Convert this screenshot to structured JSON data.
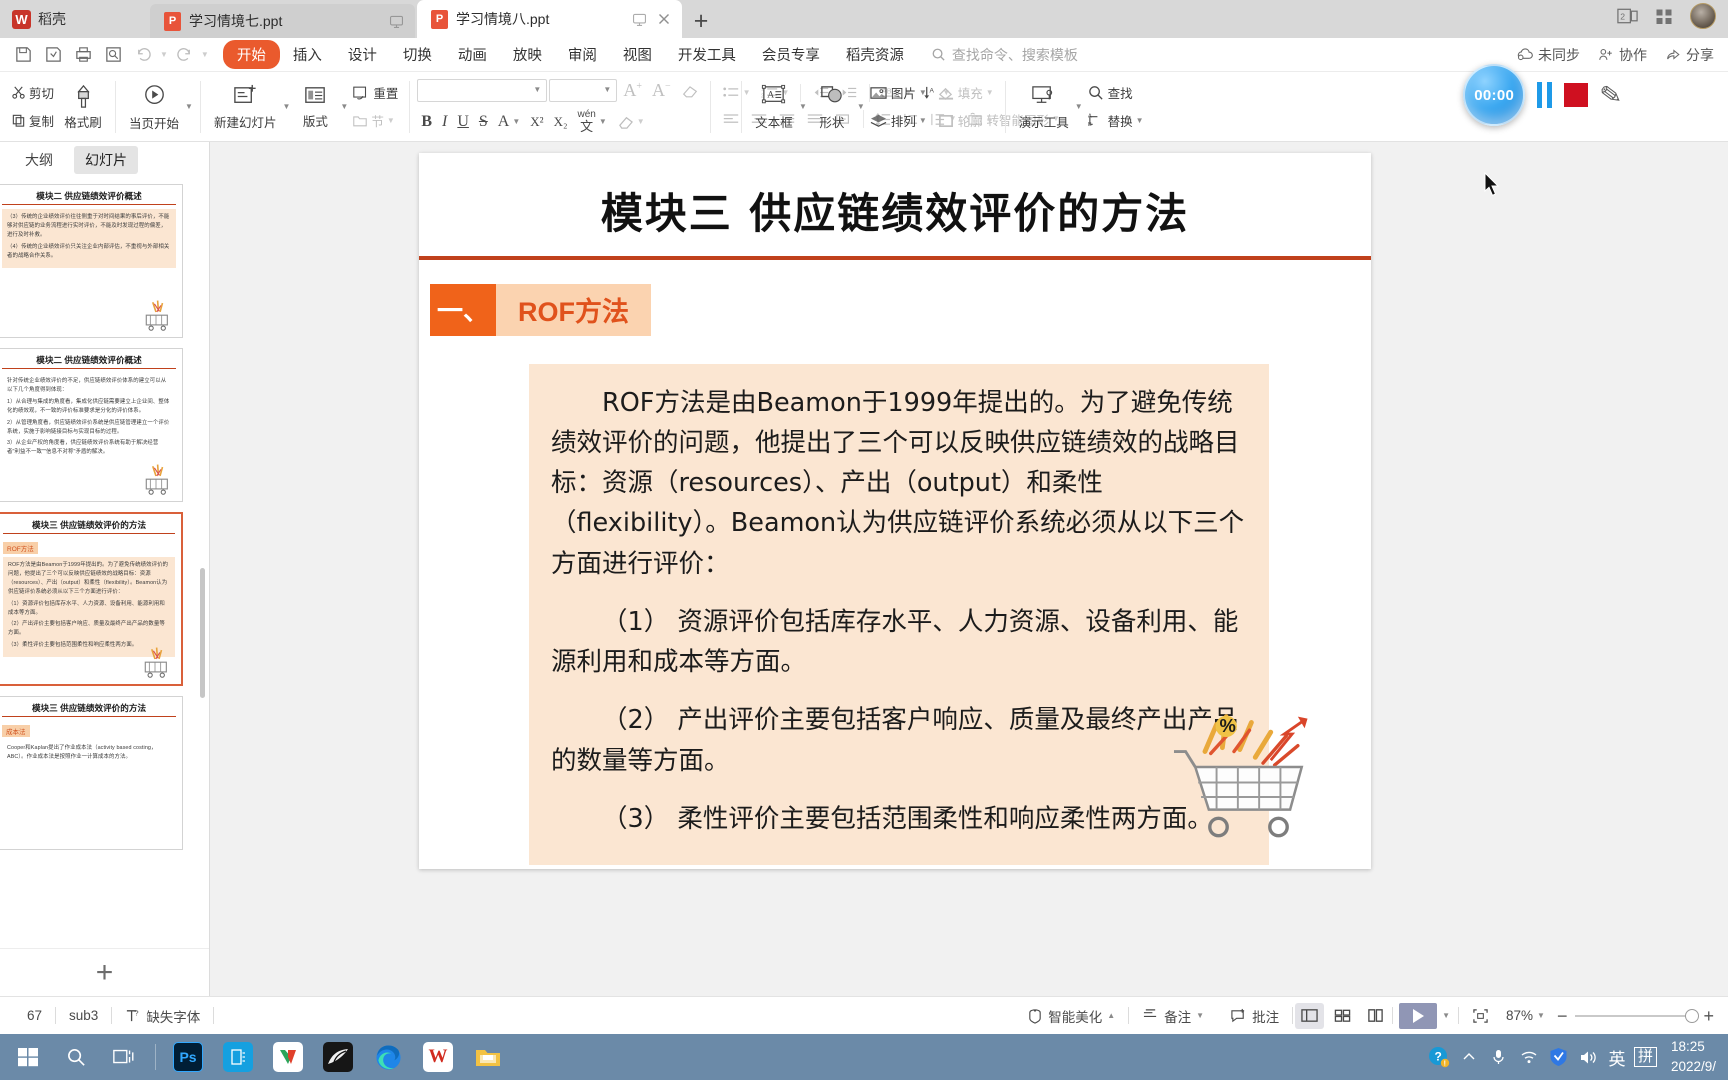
{
  "tabbar": {
    "brand": "稻壳",
    "brand_mark": "W",
    "tabs": [
      {
        "label": "学习情境七.ppt",
        "icon": "P",
        "active": false
      },
      {
        "label": "学习情境八.ppt",
        "icon": "P",
        "active": true
      }
    ],
    "new_tab": "+",
    "right_icons": [
      "two-pane-icon",
      "grid-icon",
      "avatar"
    ]
  },
  "menubar": {
    "quick_access": [
      "save-icon",
      "save-as-icon",
      "print-icon",
      "print-preview-icon",
      "undo-icon",
      "redo-icon",
      "customize-icon"
    ],
    "items": [
      {
        "label": "开始",
        "active": true
      },
      {
        "label": "插入",
        "active": false
      },
      {
        "label": "设计",
        "active": false
      },
      {
        "label": "切换",
        "active": false
      },
      {
        "label": "动画",
        "active": false
      },
      {
        "label": "放映",
        "active": false
      },
      {
        "label": "审阅",
        "active": false
      },
      {
        "label": "视图",
        "active": false
      },
      {
        "label": "开发工具",
        "active": false
      },
      {
        "label": "会员专享",
        "active": false
      },
      {
        "label": "稻壳资源",
        "active": false
      }
    ],
    "search_placeholder": "查找命令、搜索模板",
    "right": [
      {
        "label": "未同步",
        "icon": "cloud-sync-icon"
      },
      {
        "label": "协作",
        "icon": "collaborate-icon"
      },
      {
        "label": "分享",
        "icon": "share-icon"
      }
    ]
  },
  "ribbon": {
    "clipboard": [
      {
        "label": "剪切",
        "icon": "scissors-icon"
      },
      {
        "label": "复制",
        "icon": "copy-icon"
      },
      {
        "label": "格式刷",
        "icon": "format-painter-icon"
      }
    ],
    "present": {
      "label": "当页开始",
      "icon": "play-circle-icon"
    },
    "slides": [
      {
        "label": "新建幻灯片",
        "icon": "new-slide-icon"
      },
      {
        "label": "版式",
        "icon": "layout-icon"
      },
      {
        "label": "重置",
        "icon": "reset-icon"
      },
      {
        "label": "节",
        "icon": "section-icon"
      }
    ],
    "font": {
      "family_value": "",
      "size_value": "",
      "grow_label": "A",
      "shrink_label": "A",
      "clear_format_icon": "eraser-icon",
      "bold": "B",
      "italic": "I",
      "underline": "U",
      "strike": "S",
      "text_effect": "A",
      "superscript": "X²",
      "subscript": "X₂",
      "pinyin": "wén",
      "highlight_icon": "highlight-icon"
    },
    "paragraph": [
      {
        "label": "对齐文本",
        "icon": "align-text-icon"
      },
      {
        "label": "转智能图形",
        "icon": "smart-art-icon"
      }
    ],
    "drawing": [
      {
        "label": "文本框",
        "icon": "text-box-icon"
      },
      {
        "label": "形状",
        "icon": "shapes-icon"
      },
      {
        "label": "图片",
        "icon": "picture-icon"
      },
      {
        "label": "填充",
        "icon": "fill-icon"
      },
      {
        "label": "排列",
        "icon": "arrange-icon"
      },
      {
        "label": "轮廓",
        "icon": "outline-icon"
      }
    ],
    "tools": [
      {
        "label": "演示工具",
        "icon": "present-tools-icon"
      },
      {
        "label": "查找",
        "icon": "search-icon"
      },
      {
        "label": "替换",
        "icon": "replace-icon"
      }
    ],
    "recorder": {
      "timer": "00:00",
      "pause_icon": "pause-icon",
      "stop_icon": "stop-icon",
      "pen_icon": "pen-icon"
    }
  },
  "sidebar": {
    "tabs": [
      {
        "label": "大纲",
        "active": false
      },
      {
        "label": "幻灯片",
        "active": true
      }
    ],
    "add_button": "+",
    "thumbnails": [
      {
        "title": "模块二  供应链绩效评价概述",
        "tag": "",
        "lines": [
          "（3）传统的企业绩效评价往往侧重于对时间结果的事后评价，不能够对供应链的业务流程进行实时评价，不能及时发现过程的偏差，进行及时补救。",
          "（4）传统的企业绩效评价只关注企业内部评估，不重视与外部相关者的战略合作关系。"
        ],
        "selected": false
      },
      {
        "title": "模块二  供应链绩效评价概述",
        "tag": "",
        "lines": [
          "针对传统企业绩效评价的不足，供应链绩效评价体系的建立可以从以下几个角度得到体现：",
          "1）从合理与集成的角度看，集成化供应链需要建立上企业间、整体化的绩效观，不一致的评价标准要求是分化的评价体系。",
          "2）从管理角度看，供应链绩效评价系统是供应链管理建立一个评价系统，实施于影响链接目标与实现目标的过程。",
          "3）从企业产权的角度看，供应链绩效评价系统有助于解决经营者\"利益不一致\"\"信息不对称\"矛盾的解决。"
        ],
        "selected": false
      },
      {
        "title": "模块三  供应链绩效评价的方法",
        "tag": "ROF方法",
        "lines": [
          "ROF方法是由Beamon于1999年提出的。为了避免传统绩效评价的问题，他提出了三个可以反映供应链绩效的战略目标：资源（resources）、产出（output）和柔性（flexibility）。Beamon认为供应链评价系统必须从以下三个方面进行评价：",
          "（1）资源评价包括库存水平、人力资源、设备利用、能源利用和成本等方面。",
          "（2）产出评价主要包括客户响应、质量及最终产出产品的数量等方面。",
          "（3）柔性评价主要包括范围柔性和响应柔性两方面。"
        ],
        "selected": true
      },
      {
        "title": "模块三  供应链绩效评价的方法",
        "tag": "成本法",
        "lines": [
          "Cooper和Kaplan提出了作业成本法（activity based costing，ABC）。作业成本法是按照作业一计算成本的方法。"
        ],
        "selected": false
      }
    ]
  },
  "slide": {
    "title": "模块三   供应链绩效评价的方法",
    "section_number": "一、",
    "section_name": "ROF方法",
    "paragraphs": [
      "ROF方法是由Beamon于1999年提出的。为了避免传统绩效评价的问题，他提出了三个可以反映供应链绩效的战略目标：资源（resources）、产出（output）和柔性（flexibility）。Beamon认为供应链评价系统必须从以下三个方面进行评价：",
      "（1） 资源评价包括库存水平、人力资源、设备利用、能源利用和成本等方面。",
      "（2） 产出评价主要包括客户响应、质量及最终产出产品的数量等方面。",
      "（3） 柔性评价主要包括范围柔性和响应柔性两方面。"
    ],
    "decoration": "shopping-cart-graphic"
  },
  "statusbar": {
    "page_info": "67",
    "layout_name": "sub3",
    "font_warning": "缺失字体",
    "beautify": "智能美化",
    "notes": "备注",
    "comments": "批注",
    "views": [
      "normal-view-icon",
      "slide-sorter-icon",
      "reading-view-icon"
    ],
    "play": "play-icon",
    "zoom_level": "87%",
    "zoom_out": "−",
    "zoom_in": "+"
  },
  "taskbar": {
    "start_icon": "windows-start-icon",
    "search_icon": "search-icon",
    "taskview_icon": "task-view-icon",
    "apps": [
      {
        "name": "photoshop",
        "label": "Ps",
        "bg": "#001e36",
        "fg": "#31a8ff"
      },
      {
        "name": "scanner-app",
        "label": "",
        "bg": "#15a0e0",
        "fg": "#ffffff"
      },
      {
        "name": "wps-office",
        "label": "",
        "bg": "#ffffff",
        "fg": "#e84a2f"
      },
      {
        "name": "image-viewer",
        "label": "",
        "bg": "#1b1b1b",
        "fg": "#e8e8e8"
      },
      {
        "name": "microsoft-edge",
        "label": "",
        "bg": "#ffffff",
        "fg": "#0b7fd4"
      },
      {
        "name": "wps-writer",
        "label": "W",
        "bg": "#ffffff",
        "fg": "#d12b1f"
      },
      {
        "name": "file-explorer",
        "label": "",
        "bg": "#f5c243",
        "fg": "#f8d98c"
      }
    ],
    "tray": [
      {
        "name": "help-icon",
        "glyph": "?"
      },
      {
        "name": "show-hidden-icons",
        "glyph": "︿"
      },
      {
        "name": "microphone-icon",
        "glyph": "🎙"
      },
      {
        "name": "wifi-icon",
        "glyph": "◌"
      },
      {
        "name": "security-shield-icon",
        "glyph": "🛡"
      },
      {
        "name": "volume-icon",
        "glyph": "🔊"
      }
    ],
    "ime_lang": "英",
    "ime_mode": "拼",
    "clock_time": "18:25",
    "clock_date": "2022/9/"
  },
  "colors": {
    "accent_orange": "#ea5a2d",
    "slide_rule": "#c0411c",
    "content_bg": "#fbe6d2",
    "taskbar_bg": "#6b8aa8",
    "record_blue": "#1e9ae8",
    "record_red": "#cf1020"
  }
}
